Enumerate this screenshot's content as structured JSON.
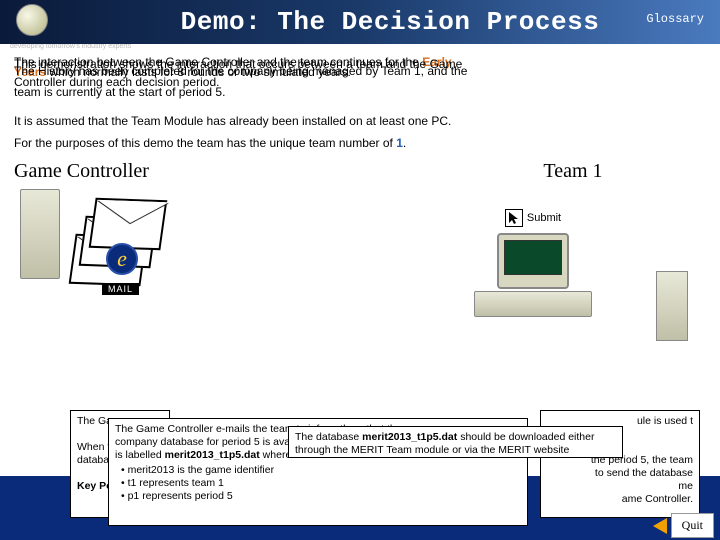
{
  "header": {
    "title": "Demo: The Decision Process",
    "glossary": "Glossary",
    "tagline": "developing tomorrow's industry experts"
  },
  "intro": {
    "line1a": "The interaction between the Game Controller and the team continues for the ",
    "line1b": "Early",
    "line2": "This demonstration shows the interaction that occurs between a team and the Game",
    "line3a": "Years",
    "line3b": " which normally lasts for 8 rounds or two simulated years.",
    "line4": "The History has been completed for the company being managed by Team 1, and the",
    "line5": "Controller during each decision period.",
    "line6": "team is currently at the start of period 5.",
    "para2": "It is assumed that the Team Module has already been installed on at least one PC.",
    "para3a": "For the purposes of this demo the team has the unique team number of ",
    "para3b": "1",
    "para3c": "."
  },
  "columns": {
    "gc_title": "Game Controller",
    "team_title": "Team 1",
    "mail_label": "MAIL",
    "e_label": "e",
    "submit": "Submit"
  },
  "boxes": {
    "box1a": "The Gam",
    "box1b": "When th",
    "box1c": "database",
    "box1d": "Key Poi",
    "box2a": "The Game Controller e-mails the team to inform them that the",
    "box2b": "company database for period 5 is ava",
    "box2c": "is labelled ",
    "box2d": "merit2013_t1p5.dat",
    "box2e": "  where",
    "box2f": "• merit2013  is the game identifier",
    "box2g": "• t1  represents team 1",
    "box2h": "• p1  represents period 5",
    "box3a": "The database ",
    "box3b": "merit2013_t1p5.dat",
    "box3c": " should be downloaded either through the MERIT Team module or via the MERIT website",
    "box4a": "ule is used t",
    "box4b": "the period 5, the team",
    "box4c": "to send the database",
    "box4d": "me",
    "box4e": "ame Controller."
  },
  "quit": {
    "label": "Quit"
  }
}
